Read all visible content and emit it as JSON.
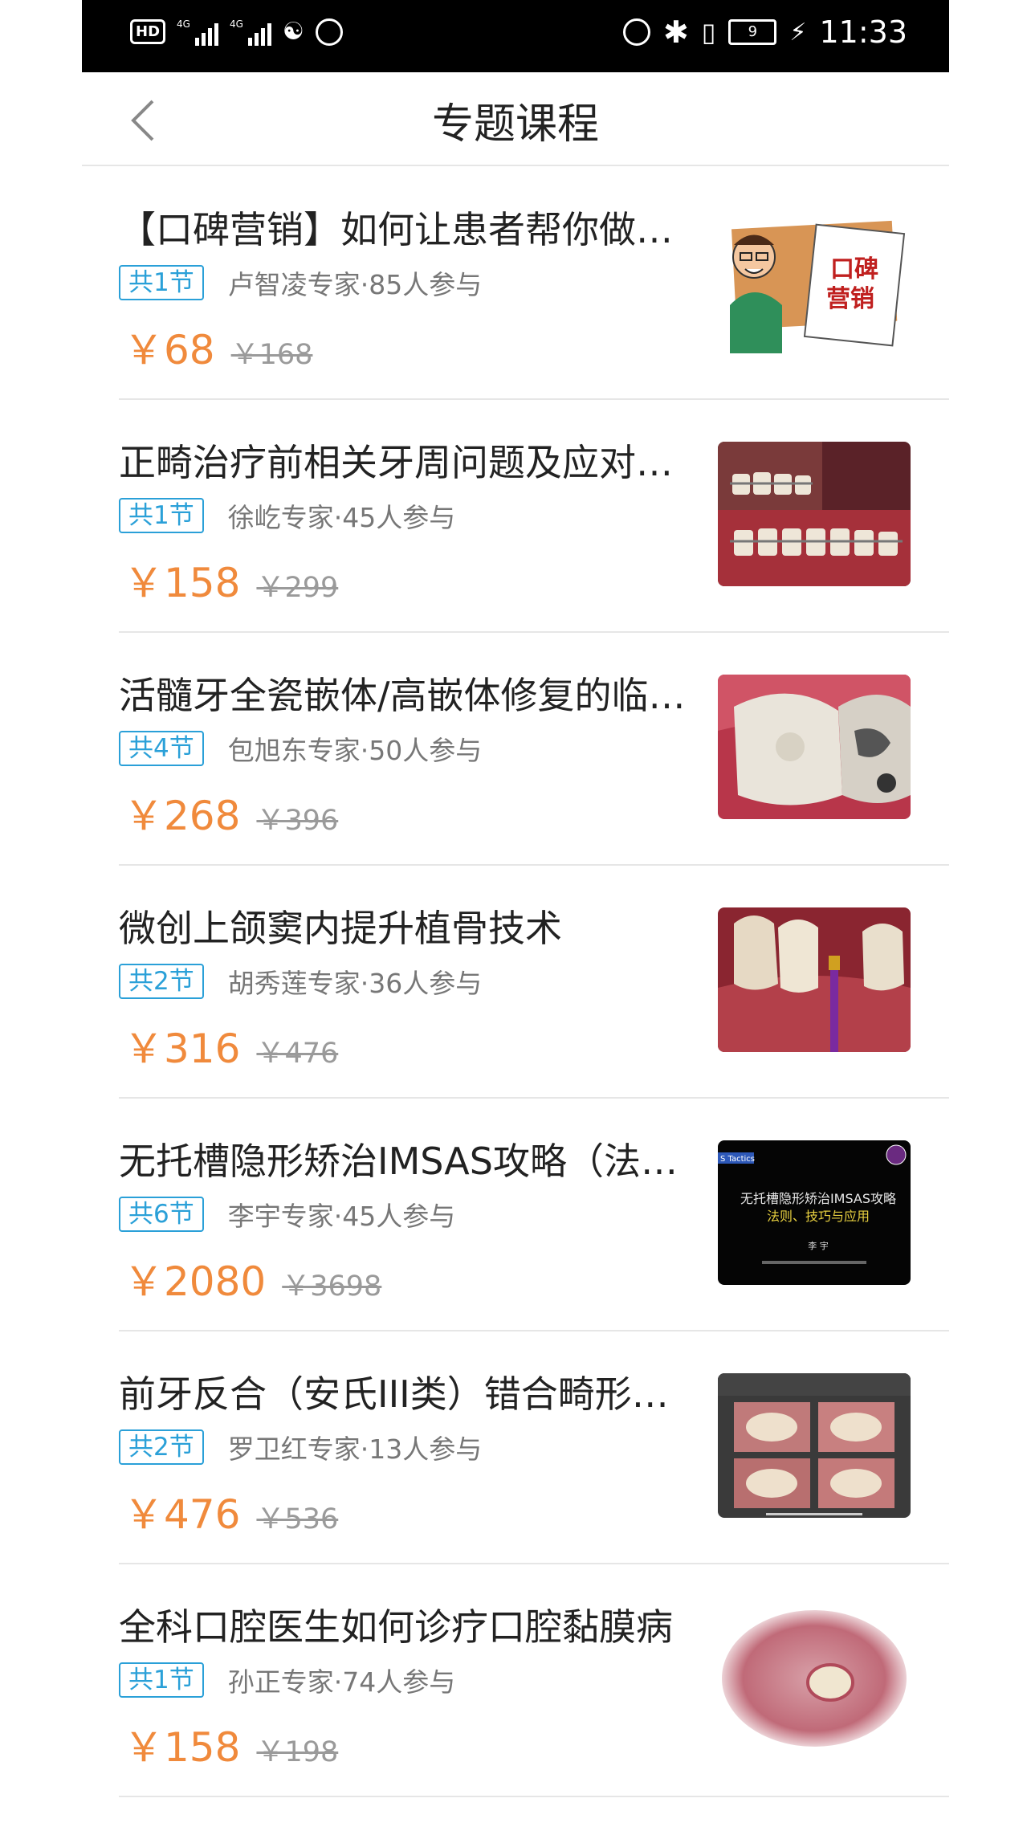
{
  "status_bar": {
    "time": "11:33",
    "battery": "9",
    "network_1": "4G",
    "network_2": "4G",
    "hd": "HD"
  },
  "header": {
    "title": "专题课程"
  },
  "courses": [
    {
      "title": "【口碑营销】如何让患者帮你做宣传",
      "badge": "共1节",
      "author": "卢智凌专家·85人参与",
      "price": "￥68",
      "original_price": "￥168",
      "thumb": "cartoon-doctor-sign",
      "thumb_text_1": "口碑",
      "thumb_text_2": "营销"
    },
    {
      "title": "正畸治疗前相关牙周问题及应对策略",
      "badge": "共1节",
      "author": "徐屹专家·45人参与",
      "price": "￥158",
      "original_price": "￥299",
      "thumb": "braces-photo"
    },
    {
      "title": "活髓牙全瓷嵌体/高嵌体修复的临床技巧",
      "badge": "共4节",
      "author": "包旭东专家·50人参与",
      "price": "￥268",
      "original_price": "￥396",
      "thumb": "inlay-molar-photo"
    },
    {
      "title": "微创上颌窦内提升植骨技术",
      "badge": "共2节",
      "author": "胡秀莲专家·36人参与",
      "price": "￥316",
      "original_price": "￥476",
      "thumb": "implant-drill-photo"
    },
    {
      "title": "无托槽隐形矫治IMSAS攻略（法则、技巧与应用）",
      "badge": "共6节",
      "author": "李宇专家·45人参与",
      "price": "￥2080",
      "original_price": "￥3698",
      "thumb": "imsas-slide",
      "thumb_text_1": "无托槽隐形矫治IMSAS攻略",
      "thumb_text_2": "法则、技巧与应用",
      "thumb_text_3": "李 宇",
      "thumb_tag": "S Tactics"
    },
    {
      "title": "前牙反合（安氏III类）错合畸形的矫治",
      "badge": "共2节",
      "author": "罗卫红专家·13人参与",
      "price": "￥476",
      "original_price": "￥536",
      "thumb": "occlusal-grid-slide"
    },
    {
      "title": "全科口腔医生如何诊疗口腔黏膜病",
      "badge": "共1节",
      "author": "孙正专家·74人参与",
      "price": "￥158",
      "original_price": "￥198",
      "thumb": "mucosa-lesion-photo"
    }
  ]
}
